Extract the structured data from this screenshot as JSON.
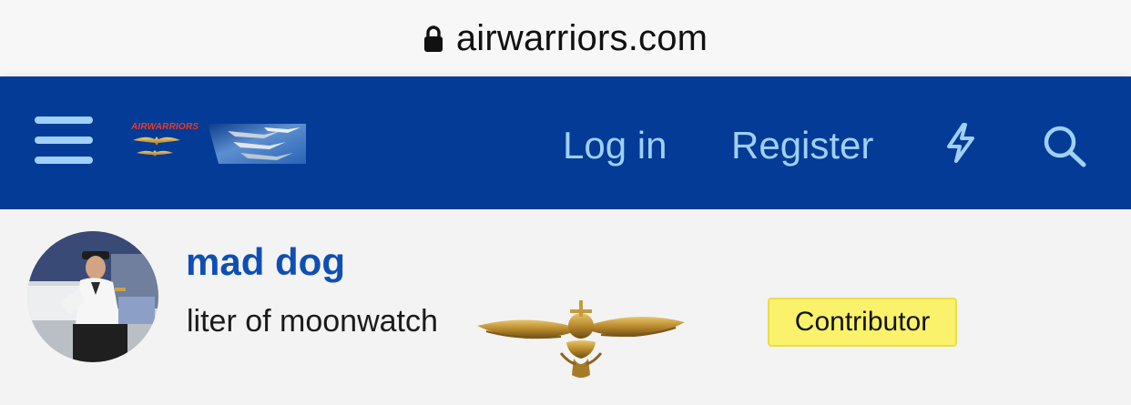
{
  "browser": {
    "url": "airwarriors.com",
    "lock_icon": "lock-icon"
  },
  "navbar": {
    "background": "#033b96",
    "link_color": "#9fd0f7",
    "menu_icon": "hamburger-icon",
    "logo_text": "AIRWARRIORS",
    "login_label": "Log in",
    "register_label": "Register",
    "whats_new_icon": "bolt-icon",
    "search_icon": "search-icon"
  },
  "profile": {
    "username": "mad dog",
    "user_title": "liter of moonwatch",
    "wings_icon": "naval-aviator-wings-icon",
    "badge": "Contributor",
    "badge_color": "#fbf26b"
  }
}
